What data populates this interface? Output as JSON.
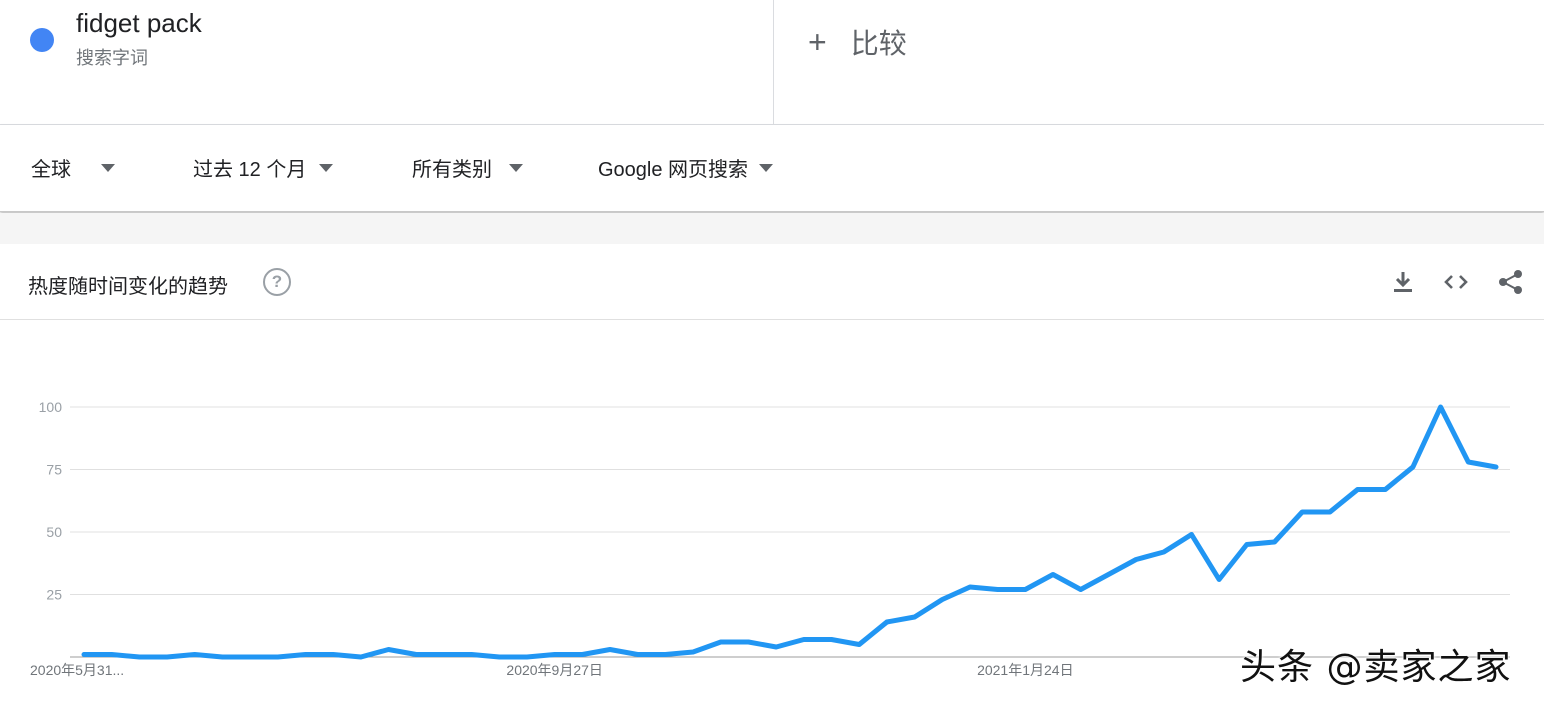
{
  "search_term": {
    "name": "fidget pack",
    "subtitle": "搜索字词",
    "color": "#4285f4"
  },
  "compare": {
    "label": "比较"
  },
  "filters": [
    {
      "label": "全球"
    },
    {
      "label": "过去 12 个月"
    },
    {
      "label": "所有类别"
    },
    {
      "label": "Google 网页搜索"
    }
  ],
  "card": {
    "title": "热度随时间变化的趋势"
  },
  "toolbar": {
    "download_icon": "download-icon",
    "embed_icon": "code-icon",
    "share_icon": "share-icon"
  },
  "watermark": "头条 @卖家之家",
  "chart_data": {
    "type": "line",
    "title": "热度随时间变化的趋势",
    "xlabel": "",
    "ylabel": "",
    "ylim": [
      0,
      100
    ],
    "y_ticks": [
      "100",
      "75",
      "50",
      "25"
    ],
    "x_tick_labels": [
      {
        "index": 0,
        "label": "2020年5月31..."
      },
      {
        "index": 17,
        "label": "2020年9月27日"
      },
      {
        "index": 34,
        "label": "2021年1月24日"
      }
    ],
    "grid": true,
    "line_color": "#2196f3",
    "series": [
      {
        "values": [
          1,
          1,
          0,
          0,
          1,
          0,
          0,
          0,
          1,
          1,
          0,
          3,
          1,
          1,
          1,
          0,
          0,
          1,
          1,
          3,
          1,
          1,
          2,
          6,
          6,
          4,
          7,
          7,
          5,
          14,
          16,
          23,
          28,
          27,
          27,
          33,
          27,
          33,
          39,
          42,
          49,
          31,
          45,
          46,
          58,
          58,
          67,
          67,
          76,
          100,
          78,
          76
        ]
      }
    ]
  }
}
